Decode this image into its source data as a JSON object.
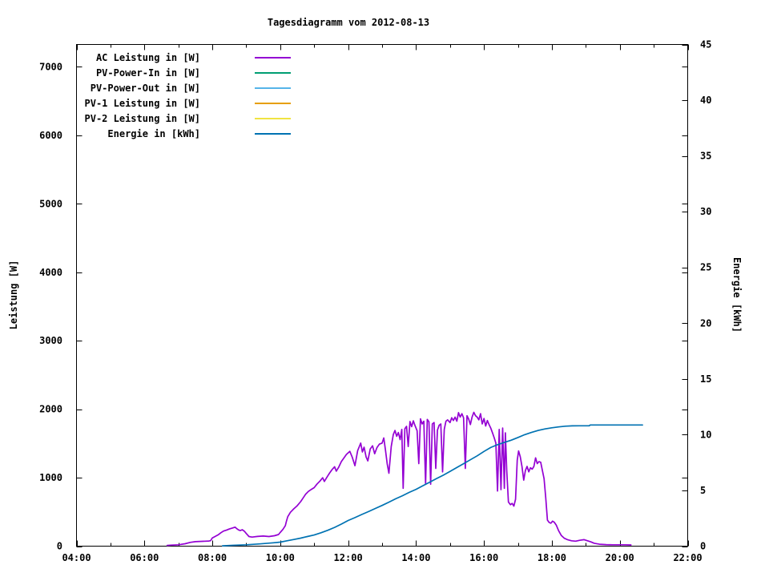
{
  "title": "Tagesdiagramm vom 2012-08-13",
  "colors": {
    "background": "#ffffff",
    "frame": "#000000",
    "text": "#000000"
  },
  "legend": {
    "items": [
      {
        "label": "AC Leistung in [W]",
        "color": "#9400d3"
      },
      {
        "label": "PV-Power-In in [W]",
        "color": "#009e73"
      },
      {
        "label": "PV-Power-Out in [W]",
        "color": "#56b4e9"
      },
      {
        "label": "PV-1 Leistung in [W]",
        "color": "#e69f00"
      },
      {
        "label": "PV-2 Leistung in [W]",
        "color": "#f0e442"
      },
      {
        "label": "Energie in [kWh]",
        "color": "#0072b2"
      }
    ]
  },
  "axes": {
    "x": {
      "major_hours": [
        4,
        6,
        8,
        10,
        12,
        14,
        16,
        18,
        20,
        22
      ],
      "major_labels": [
        "04:00",
        "06:00",
        "08:00",
        "10:00",
        "12:00",
        "14:00",
        "16:00",
        "18:00",
        "20:00",
        "22:00"
      ],
      "minor_hours": [
        5,
        7,
        9,
        11,
        13,
        15,
        17,
        19,
        21
      ],
      "range_hours": [
        4,
        22
      ]
    },
    "left": {
      "title": "Leistung [W]",
      "tick_values": [
        0,
        1000,
        2000,
        3000,
        4000,
        5000,
        6000,
        7000
      ],
      "tick_labels": [
        "0",
        "1000",
        "2000",
        "3000",
        "4000",
        "5000",
        "6000",
        "7000"
      ],
      "range": [
        0,
        7327
      ]
    },
    "right": {
      "title": "Energie [kWh]",
      "tick_values": [
        0,
        5,
        10,
        15,
        20,
        25,
        30,
        35,
        40,
        45
      ],
      "tick_labels": [
        "0",
        "5",
        "10",
        "15",
        "20",
        "25",
        "30",
        "35",
        "40",
        "45"
      ],
      "range": [
        0,
        45
      ]
    }
  },
  "chart_data": {
    "type": "line",
    "title": "Tagesdiagramm vom 2012-08-13",
    "x_unit": "decimal_hours",
    "x_range": [
      4,
      22
    ],
    "ylim_left": [
      0,
      7327
    ],
    "ylim_right": [
      0,
      45
    ],
    "grid": false,
    "legend_position": "top-left-inside",
    "series": [
      {
        "name": "AC Leistung in [W]",
        "color": "#9400d3",
        "axis": "left",
        "unit": "W",
        "visible_in_plot": true,
        "points": [
          [
            6.67,
            10
          ],
          [
            6.8,
            15
          ],
          [
            7.0,
            20
          ],
          [
            7.2,
            35
          ],
          [
            7.35,
            55
          ],
          [
            7.5,
            65
          ],
          [
            7.7,
            70
          ],
          [
            7.9,
            75
          ],
          [
            7.95,
            80
          ],
          [
            8.0,
            120
          ],
          [
            8.08,
            140
          ],
          [
            8.17,
            165
          ],
          [
            8.25,
            195
          ],
          [
            8.33,
            220
          ],
          [
            8.42,
            235
          ],
          [
            8.5,
            250
          ],
          [
            8.58,
            262
          ],
          [
            8.67,
            277
          ],
          [
            8.72,
            255
          ],
          [
            8.78,
            235
          ],
          [
            8.83,
            228
          ],
          [
            8.88,
            240
          ],
          [
            8.95,
            215
          ],
          [
            9.0,
            185
          ],
          [
            9.08,
            140
          ],
          [
            9.17,
            132
          ],
          [
            9.33,
            142
          ],
          [
            9.5,
            148
          ],
          [
            9.67,
            140
          ],
          [
            9.83,
            152
          ],
          [
            9.95,
            170
          ],
          [
            10.0,
            200
          ],
          [
            10.08,
            245
          ],
          [
            10.15,
            300
          ],
          [
            10.18,
            360
          ],
          [
            10.22,
            430
          ],
          [
            10.3,
            495
          ],
          [
            10.4,
            545
          ],
          [
            10.5,
            590
          ],
          [
            10.6,
            650
          ],
          [
            10.67,
            700
          ],
          [
            10.75,
            760
          ],
          [
            10.83,
            800
          ],
          [
            10.92,
            830
          ],
          [
            11.0,
            855
          ],
          [
            11.08,
            905
          ],
          [
            11.17,
            950
          ],
          [
            11.25,
            1000
          ],
          [
            11.3,
            945
          ],
          [
            11.38,
            1010
          ],
          [
            11.45,
            1065
          ],
          [
            11.53,
            1120
          ],
          [
            11.6,
            1160
          ],
          [
            11.65,
            1095
          ],
          [
            11.72,
            1150
          ],
          [
            11.8,
            1235
          ],
          [
            11.88,
            1290
          ],
          [
            11.95,
            1340
          ],
          [
            12.05,
            1385
          ],
          [
            12.12,
            1300
          ],
          [
            12.2,
            1175
          ],
          [
            12.28,
            1395
          ],
          [
            12.37,
            1505
          ],
          [
            12.42,
            1375
          ],
          [
            12.47,
            1445
          ],
          [
            12.53,
            1300
          ],
          [
            12.58,
            1245
          ],
          [
            12.65,
            1420
          ],
          [
            12.72,
            1465
          ],
          [
            12.78,
            1350
          ],
          [
            12.85,
            1440
          ],
          [
            12.92,
            1490
          ],
          [
            13.0,
            1505
          ],
          [
            13.05,
            1580
          ],
          [
            13.1,
            1405
          ],
          [
            13.15,
            1200
          ],
          [
            13.2,
            1065
          ],
          [
            13.27,
            1455
          ],
          [
            13.33,
            1630
          ],
          [
            13.38,
            1690
          ],
          [
            13.43,
            1605
          ],
          [
            13.48,
            1660
          ],
          [
            13.53,
            1555
          ],
          [
            13.58,
            1705
          ],
          [
            13.62,
            845
          ],
          [
            13.67,
            1715
          ],
          [
            13.72,
            1750
          ],
          [
            13.77,
            1455
          ],
          [
            13.82,
            1820
          ],
          [
            13.87,
            1745
          ],
          [
            13.92,
            1830
          ],
          [
            13.97,
            1760
          ],
          [
            14.03,
            1685
          ],
          [
            14.08,
            1205
          ],
          [
            14.13,
            1860
          ],
          [
            14.18,
            1785
          ],
          [
            14.23,
            1825
          ],
          [
            14.28,
            905
          ],
          [
            14.33,
            1850
          ],
          [
            14.38,
            1815
          ],
          [
            14.43,
            905
          ],
          [
            14.48,
            1785
          ],
          [
            14.53,
            1805
          ],
          [
            14.58,
            1135
          ],
          [
            14.63,
            1695
          ],
          [
            14.68,
            1765
          ],
          [
            14.73,
            1785
          ],
          [
            14.78,
            1085
          ],
          [
            14.83,
            1705
          ],
          [
            14.88,
            1825
          ],
          [
            14.93,
            1845
          ],
          [
            15.0,
            1805
          ],
          [
            15.05,
            1875
          ],
          [
            15.1,
            1835
          ],
          [
            15.15,
            1885
          ],
          [
            15.2,
            1825
          ],
          [
            15.25,
            1950
          ],
          [
            15.3,
            1885
          ],
          [
            15.35,
            1935
          ],
          [
            15.4,
            1875
          ],
          [
            15.45,
            1135
          ],
          [
            15.5,
            1905
          ],
          [
            15.55,
            1855
          ],
          [
            15.6,
            1775
          ],
          [
            15.65,
            1885
          ],
          [
            15.7,
            1955
          ],
          [
            15.75,
            1905
          ],
          [
            15.8,
            1885
          ],
          [
            15.85,
            1845
          ],
          [
            15.9,
            1935
          ],
          [
            15.95,
            1785
          ],
          [
            16.0,
            1865
          ],
          [
            16.05,
            1755
          ],
          [
            16.1,
            1835
          ],
          [
            16.15,
            1775
          ],
          [
            16.2,
            1725
          ],
          [
            16.25,
            1655
          ],
          [
            16.3,
            1585
          ],
          [
            16.35,
            1505
          ],
          [
            16.4,
            805
          ],
          [
            16.45,
            1705
          ],
          [
            16.5,
            825
          ],
          [
            16.55,
            1725
          ],
          [
            16.6,
            845
          ],
          [
            16.63,
            1655
          ],
          [
            16.67,
            1105
          ],
          [
            16.72,
            645
          ],
          [
            16.78,
            605
          ],
          [
            16.83,
            625
          ],
          [
            16.88,
            585
          ],
          [
            16.93,
            685
          ],
          [
            16.98,
            1255
          ],
          [
            17.02,
            1390
          ],
          [
            17.07,
            1305
          ],
          [
            17.12,
            1165
          ],
          [
            17.17,
            965
          ],
          [
            17.22,
            1105
          ],
          [
            17.27,
            1165
          ],
          [
            17.32,
            1085
          ],
          [
            17.37,
            1145
          ],
          [
            17.42,
            1125
          ],
          [
            17.47,
            1165
          ],
          [
            17.52,
            1290
          ],
          [
            17.57,
            1205
          ],
          [
            17.62,
            1235
          ],
          [
            17.67,
            1225
          ],
          [
            17.72,
            1105
          ],
          [
            17.77,
            985
          ],
          [
            17.82,
            705
          ],
          [
            17.87,
            380
          ],
          [
            17.92,
            345
          ],
          [
            17.97,
            335
          ],
          [
            18.02,
            365
          ],
          [
            18.07,
            350
          ],
          [
            18.13,
            305
          ],
          [
            18.2,
            225
          ],
          [
            18.28,
            155
          ],
          [
            18.37,
            115
          ],
          [
            18.47,
            92
          ],
          [
            18.58,
            78
          ],
          [
            18.7,
            72
          ],
          [
            18.82,
            85
          ],
          [
            18.95,
            95
          ],
          [
            19.05,
            78
          ],
          [
            19.15,
            62
          ],
          [
            19.25,
            42
          ],
          [
            19.4,
            28
          ],
          [
            19.6,
            22
          ],
          [
            19.8,
            20
          ],
          [
            20.0,
            20
          ],
          [
            20.17,
            20
          ],
          [
            20.33,
            18
          ]
        ]
      },
      {
        "name": "PV-Power-In in [W]",
        "color": "#009e73",
        "axis": "left",
        "unit": "W",
        "visible_in_plot": false,
        "points": []
      },
      {
        "name": "PV-Power-Out in [W]",
        "color": "#56b4e9",
        "axis": "left",
        "unit": "W",
        "visible_in_plot": false,
        "points": []
      },
      {
        "name": "PV-1 Leistung in [W]",
        "color": "#e69f00",
        "axis": "left",
        "unit": "W",
        "visible_in_plot": false,
        "points": []
      },
      {
        "name": "PV-2 Leistung in [W]",
        "color": "#f0e442",
        "axis": "left",
        "unit": "W",
        "visible_in_plot": false,
        "points": []
      },
      {
        "name": "Energie in [kWh]",
        "color": "#0072b2",
        "axis": "right",
        "unit": "kWh",
        "visible_in_plot": true,
        "points": [
          [
            8.3,
            0.03
          ],
          [
            8.6,
            0.07
          ],
          [
            9.0,
            0.12
          ],
          [
            9.4,
            0.2
          ],
          [
            9.8,
            0.3
          ],
          [
            10.0,
            0.36
          ],
          [
            10.2,
            0.48
          ],
          [
            10.4,
            0.6
          ],
          [
            10.6,
            0.72
          ],
          [
            10.8,
            0.86
          ],
          [
            11.0,
            1.0
          ],
          [
            11.2,
            1.2
          ],
          [
            11.4,
            1.42
          ],
          [
            11.6,
            1.68
          ],
          [
            11.8,
            1.98
          ],
          [
            12.0,
            2.3
          ],
          [
            12.2,
            2.56
          ],
          [
            12.4,
            2.84
          ],
          [
            12.6,
            3.1
          ],
          [
            12.8,
            3.38
          ],
          [
            13.0,
            3.65
          ],
          [
            13.2,
            3.95
          ],
          [
            13.4,
            4.25
          ],
          [
            13.6,
            4.52
          ],
          [
            13.8,
            4.82
          ],
          [
            14.0,
            5.1
          ],
          [
            14.2,
            5.42
          ],
          [
            14.4,
            5.74
          ],
          [
            14.6,
            6.05
          ],
          [
            14.8,
            6.36
          ],
          [
            15.0,
            6.7
          ],
          [
            15.2,
            7.05
          ],
          [
            15.4,
            7.4
          ],
          [
            15.6,
            7.75
          ],
          [
            15.8,
            8.1
          ],
          [
            16.0,
            8.5
          ],
          [
            16.2,
            8.85
          ],
          [
            16.4,
            9.1
          ],
          [
            16.6,
            9.3
          ],
          [
            16.8,
            9.5
          ],
          [
            17.0,
            9.75
          ],
          [
            17.2,
            10.0
          ],
          [
            17.4,
            10.2
          ],
          [
            17.6,
            10.38
          ],
          [
            17.8,
            10.52
          ],
          [
            18.0,
            10.62
          ],
          [
            18.2,
            10.7
          ],
          [
            18.4,
            10.76
          ],
          [
            18.6,
            10.79
          ],
          [
            18.8,
            10.8
          ],
          [
            19.1,
            10.8
          ],
          [
            19.13,
            10.87
          ],
          [
            19.5,
            10.87
          ],
          [
            20.0,
            10.87
          ],
          [
            20.4,
            10.87
          ],
          [
            20.67,
            10.87
          ]
        ]
      }
    ]
  }
}
